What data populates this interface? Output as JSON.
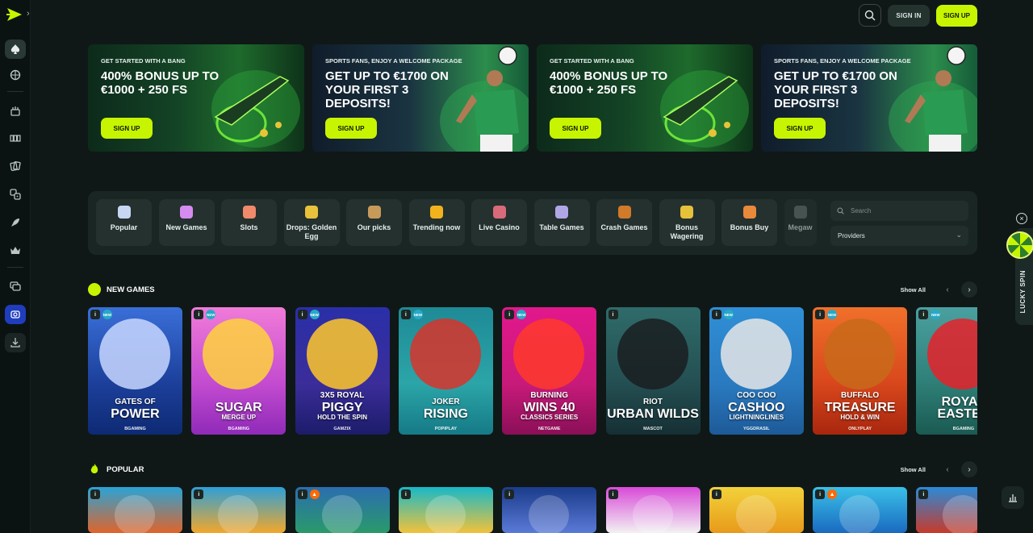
{
  "sidebar": {
    "items": [
      "spade-icon",
      "ball-icon",
      "cake-icon",
      "slot-icon",
      "cards-icon",
      "dice-icon",
      "rocket-icon",
      "crown-icon",
      "chat-icon",
      "camera-icon",
      "download-icon"
    ]
  },
  "topbar": {
    "signin_label": "SIGN IN",
    "signup_label": "SIGN UP"
  },
  "banners": [
    {
      "kicker": "GET STARTED WITH A BANG",
      "headline": "400% BONUS UP TO €1000 + 250 FS",
      "button": "SIGN UP"
    },
    {
      "kicker": "SPORTS FANS, ENJOY A WELCOME PACKAGE",
      "headline": "GET UP TO €1700 ON YOUR FIRST 3 DEPOSITS!",
      "button": "SIGN UP"
    },
    {
      "kicker": "GET STARTED WITH A BANG",
      "headline": "400% BONUS UP TO €1000 + 250 FS",
      "button": "SIGN UP"
    },
    {
      "kicker": "SPORTS FANS, ENJOY A WELCOME PACKAGE",
      "headline": "GET UP TO €1700 ON YOUR FIRST 3 DEPOSITS!",
      "button": "SIGN UP"
    }
  ],
  "categories": [
    {
      "label": "Popular",
      "icon": "dice-icon",
      "color": "#c7d7f2"
    },
    {
      "label": "New Games",
      "icon": "gift-icon",
      "color": "#d58cf0"
    },
    {
      "label": "Slots",
      "icon": "slot-icon",
      "color": "#f08a6a"
    },
    {
      "label": "Drops: Golden Egg",
      "icon": "egg-icon",
      "color": "#e8c23a"
    },
    {
      "label": "Our picks",
      "icon": "ball-icon",
      "color": "#c79a5a"
    },
    {
      "label": "Trending now",
      "icon": "crown-icon",
      "color": "#f2b21c"
    },
    {
      "label": "Live Casino",
      "icon": "dealer-icon",
      "color": "#d96a7a"
    },
    {
      "label": "Table Games",
      "icon": "cards-icon",
      "color": "#b0a6e6"
    },
    {
      "label": "Crash Games",
      "icon": "coin-icon",
      "color": "#d07a2a"
    },
    {
      "label": "Bonus Wagering",
      "icon": "horseshoe-icon",
      "color": "#e6c13a"
    },
    {
      "label": "Bonus Buy",
      "icon": "cart-icon",
      "color": "#e88a3a"
    },
    {
      "label": "Megaw",
      "icon": "megaways-icon",
      "color": "#6d7876"
    }
  ],
  "search": {
    "placeholder": "Search"
  },
  "providers": {
    "label": "Providers"
  },
  "sections": {
    "new_games": {
      "title": "NEW GAMES",
      "show_all": "Show All"
    },
    "popular": {
      "title": "POPULAR",
      "show_all": "Show All"
    }
  },
  "new_games": [
    {
      "l1": "GATES OF",
      "l2": "POWER",
      "provider": "BGAMING",
      "badge": "new",
      "bg": "linear-gradient(180deg,#3a6fd8,#1c3f9a 60%,#0e2a74)",
      "blob": "#c8d7ff"
    },
    {
      "l1": "",
      "l2": "SUGAR",
      "sub": "MERGE UP",
      "provider": "BGAMING",
      "badge": "new",
      "bg": "linear-gradient(180deg,#f07bd8,#c34bd0 60%,#8f2ab8)",
      "blob": "#ffd23c"
    },
    {
      "l1": "3X5 ROYAL",
      "l2": "PIGGY",
      "sub": "HOLD THE SPIN",
      "provider": "GAMZIX",
      "badge": "new",
      "bg": "linear-gradient(180deg,#2a2fa8,#3b2d9a 60%,#1c1c6a)",
      "blob": "#ffc82a"
    },
    {
      "l1": "JOKER",
      "l2": "RISING",
      "provider": "POPIPLAY",
      "badge": "new",
      "bg": "linear-gradient(180deg,#1e8a96,#2ba5a8 60%,#157a86)",
      "blob": "#d8342a"
    },
    {
      "l1": "BURNING",
      "l2": "WINS 40",
      "sub": "CLASSIC5 SERIES",
      "provider": "NETGAME",
      "badge": "new",
      "bg": "linear-gradient(180deg,#e2188c,#c81a7a 60%,#8a0f57)",
      "blob": "#ff3a2a"
    },
    {
      "l1": "RIOT",
      "l2": "URBAN WILDS",
      "provider": "MASCOT",
      "badge": "",
      "bg": "linear-gradient(180deg,#2f6b6a,#244f52 60%,#152f34)",
      "blob": "#1a1d20"
    },
    {
      "l1": "COO COO",
      "l2": "CASHOO",
      "sub": "LIGHTNINGLINES",
      "provider": "YGGDRASIL",
      "badge": "new",
      "bg": "linear-gradient(180deg,#2f8fd6,#2a7ac0 60%,#1d5a98)",
      "blob": "#e6e6e6"
    },
    {
      "l1": "BUFFALO",
      "l2": "TREASURE",
      "sub": "HOLD & WIN",
      "provider": "ONLYPLAY",
      "badge": "new",
      "bg": "linear-gradient(180deg,#f0702a,#d8471c 60%,#a8260e)",
      "blob": "#c86a1a"
    },
    {
      "l1": "",
      "l2": "ROYAL EASTER",
      "provider": "BGAMING",
      "badge": "new",
      "bg": "linear-gradient(180deg,#4aa0a0,#2e7f77 60%,#1a5a52)",
      "blob": "#e8212a"
    }
  ],
  "popular_games": [
    {
      "badge": "",
      "bg": "linear-gradient(180deg,#2aa3d6,#e0642a)"
    },
    {
      "badge": "",
      "bg": "linear-gradient(180deg,#2d9fd8,#f3a72a)"
    },
    {
      "badge": "hot",
      "bg": "linear-gradient(180deg,#2b6db0,#2a9a6a)"
    },
    {
      "badge": "",
      "bg": "linear-gradient(180deg,#17b8c8,#f2c23a)"
    },
    {
      "badge": "",
      "bg": "linear-gradient(180deg,#1b3b8a,#5a7ad8)"
    },
    {
      "badge": "",
      "bg": "linear-gradient(180deg,#d84ad8,#f2f2f2)"
    },
    {
      "badge": "",
      "bg": "linear-gradient(180deg,#f2d23a,#e89a1a)"
    },
    {
      "badge": "hot",
      "bg": "linear-gradient(180deg,#3ac0e8,#1a6ac0)"
    },
    {
      "badge": "",
      "bg": "linear-gradient(180deg,#2a8ad8,#c83a2a)"
    }
  ],
  "lucky_spin": {
    "label": "LUCKY SPIN"
  },
  "colors": {
    "accent": "#c7f400",
    "background": "#0f1817",
    "panel": "#1a2624"
  }
}
